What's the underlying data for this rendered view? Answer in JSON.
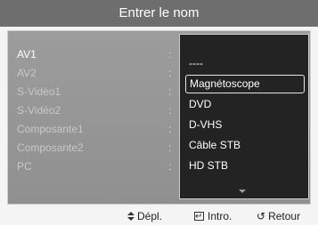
{
  "title": "Entrer le nom",
  "sources": [
    {
      "label": "AV1",
      "active": true
    },
    {
      "label": "AV2",
      "active": false
    },
    {
      "label": "S-Vidéo1",
      "active": false
    },
    {
      "label": "S-Vidéo2",
      "active": false
    },
    {
      "label": "Composante1",
      "active": false
    },
    {
      "label": "Composante2",
      "active": false
    },
    {
      "label": "PC",
      "active": false
    }
  ],
  "colon": ":",
  "dropdown": {
    "items": [
      "----",
      "Magnétoscope",
      "DVD",
      "D-VHS",
      "Câble STB",
      "HD STB"
    ],
    "selected_index": 1,
    "more_indicator": "scroll-down-arrow-icon"
  },
  "footer": {
    "move_label": "Dépl.",
    "enter_label": "Intro.",
    "return_label": "Retour",
    "return_icon": "↺"
  },
  "colors": {
    "title_bar": "#6e6e6e",
    "panel": "#969696",
    "dropdown_bg": "#232323",
    "active_text": "#ffffff",
    "inactive_text": "#c8c8c8"
  }
}
